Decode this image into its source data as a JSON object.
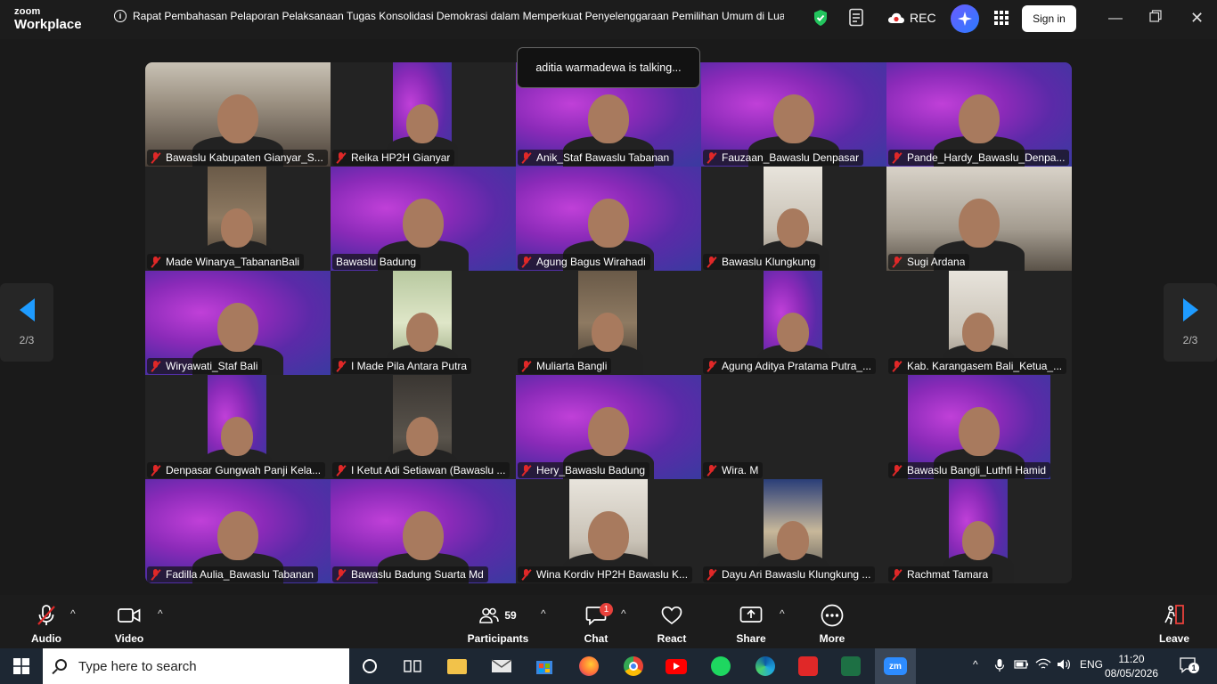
{
  "app": {
    "brand_top": "zoom",
    "brand_bottom": "Workplace"
  },
  "meeting": {
    "title": "Rapat Pembahasan Pelaporan Pelaksanaan Tugas Konsolidasi Demokrasi dalam Memperkuat Penyelenggaraan Pemilihan Umum di Luar Ta"
  },
  "titlebar": {
    "rec_label": "REC",
    "signin_label": "Sign in"
  },
  "talking_indicator": "aditia warmadewa is talking...",
  "pagination": {
    "left_label": "2/3",
    "right_label": "2/3"
  },
  "participants": [
    {
      "name": "Bawaslu Kabupaten Gianyar_S...",
      "muted": true,
      "bg": "office",
      "video": "full"
    },
    {
      "name": "Reika  HP2H Gianyar",
      "muted": true,
      "bg": "purple",
      "video": "narrow"
    },
    {
      "name": "Anik_Staf Bawaslu Tabanan",
      "muted": true,
      "bg": "purple",
      "video": "full"
    },
    {
      "name": "Fauzaan_Bawaslu Denpasar",
      "muted": true,
      "bg": "purple",
      "video": "full"
    },
    {
      "name": "Pande_Hardy_Bawaslu_Denpa...",
      "muted": true,
      "bg": "purple",
      "video": "full"
    },
    {
      "name": "Made Winarya_TabananBali",
      "muted": true,
      "bg": "room",
      "video": "narrow"
    },
    {
      "name": "Bawaslu Badung",
      "muted": false,
      "bg": "purple",
      "video": "full"
    },
    {
      "name": "Agung Bagus Wirahadi",
      "muted": true,
      "bg": "purple",
      "video": "full"
    },
    {
      "name": "Bawaslu Klungkung",
      "muted": true,
      "bg": "light",
      "video": "narrow"
    },
    {
      "name": "Sugi Ardana",
      "muted": true,
      "bg": "gray",
      "video": "full"
    },
    {
      "name": "Wiryawati_Staf Bali",
      "muted": true,
      "bg": "purple",
      "video": "full"
    },
    {
      "name": "I Made Pila Antara Putra",
      "muted": true,
      "bg": "green",
      "video": "narrow"
    },
    {
      "name": "Muliarta Bangli",
      "muted": true,
      "bg": "room",
      "video": "narrow"
    },
    {
      "name": "Agung Aditya Pratama Putra_...",
      "muted": true,
      "bg": "purple",
      "video": "narrow"
    },
    {
      "name": "Kab. Karangasem Bali_Ketua_...",
      "muted": true,
      "bg": "light",
      "video": "narrow"
    },
    {
      "name": "Denpasar Gungwah Panji Kela...",
      "muted": true,
      "bg": "purple",
      "video": "narrow"
    },
    {
      "name": "I Ketut Adi Setiawan (Bawaslu ...",
      "muted": true,
      "bg": "dark",
      "video": "narrow"
    },
    {
      "name": "Hery_Bawaslu Badung",
      "muted": true,
      "bg": "purple",
      "video": "full"
    },
    {
      "name": "Wira. M",
      "muted": true,
      "bg": "none",
      "video": "none"
    },
    {
      "name": "Bawaslu Bangli_Luthfi Hamid",
      "muted": true,
      "bg": "purple",
      "video": "wide"
    },
    {
      "name": "Fadilla Aulia_Bawaslu Tabanan",
      "muted": true,
      "bg": "purple",
      "video": "full"
    },
    {
      "name": "Bawaslu Badung Suarta Md",
      "muted": true,
      "bg": "purple",
      "video": "full"
    },
    {
      "name": "Wina Kordiv HP2H Bawaslu K...",
      "muted": true,
      "bg": "light",
      "video": "mid"
    },
    {
      "name": "Dayu Ari Bawaslu Klungkung ...",
      "muted": true,
      "bg": "blue",
      "video": "narrow"
    },
    {
      "name": "Rachmat Tamara",
      "muted": true,
      "bg": "purple",
      "video": "narrow"
    }
  ],
  "toolbar": {
    "audio": "Audio",
    "video": "Video",
    "participants": "Participants",
    "participants_count": "59",
    "chat": "Chat",
    "chat_badge": "1",
    "react": "React",
    "share": "Share",
    "more": "More",
    "leave": "Leave"
  },
  "colors": {
    "accent": "#1e9bff",
    "danger": "#e02828",
    "badge": "#e8413b",
    "leave": "#e8413b"
  },
  "taskbar": {
    "search_placeholder": "Type here to search",
    "lang": "ENG",
    "time": "11:20",
    "date": "08/05/2026",
    "notification_count": "1"
  }
}
